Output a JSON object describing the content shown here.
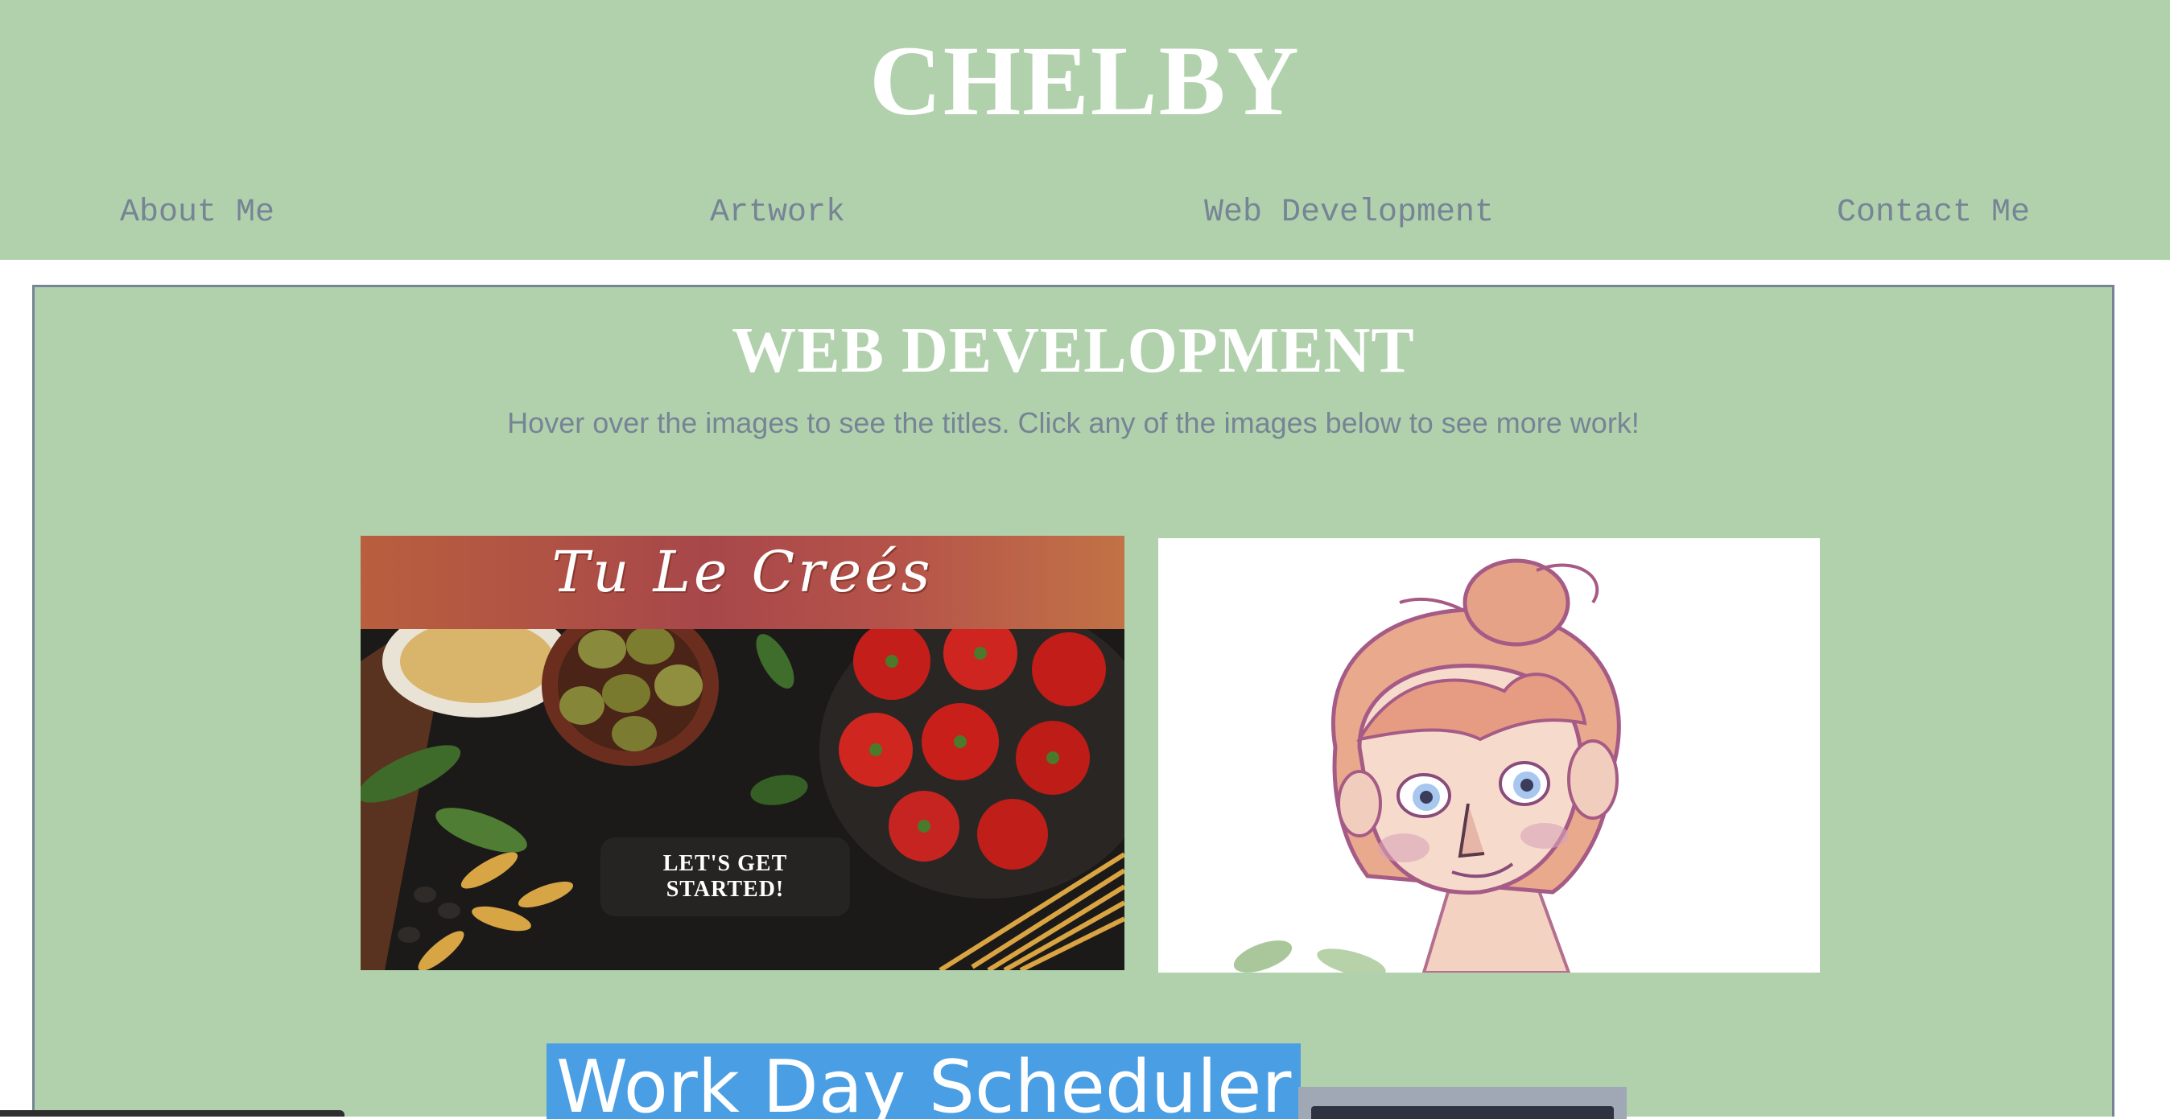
{
  "header": {
    "site_title": "CHELBY",
    "nav": [
      {
        "label": "About Me"
      },
      {
        "label": "Artwork"
      },
      {
        "label": "Web Development"
      },
      {
        "label": "Contact Me"
      }
    ]
  },
  "main": {
    "section_title": "WEB DEVELOPMENT",
    "instructions": "Hover over the images to see the titles. Click any of the images below to see more work!",
    "projects": [
      {
        "logo_text": "Tu Le Creés",
        "cta_label": "LET'S GET STARTED!"
      },
      {
        "image_subject": "character-portrait"
      },
      {
        "hover_title": "Work Day Scheduler"
      }
    ]
  },
  "colors": {
    "header_bg": "#b0d1ac",
    "panel_bg": "#b0d1ac",
    "nav_text": "#768496",
    "title_text": "#ffffff",
    "highlight": "#4a9ee4"
  }
}
